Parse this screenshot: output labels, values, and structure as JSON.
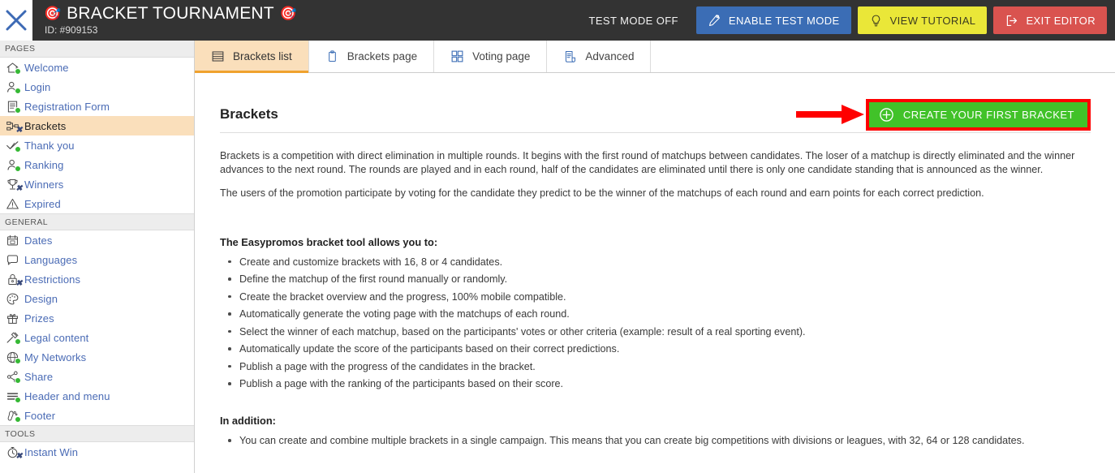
{
  "topbar": {
    "close_icon": "close-x-icon",
    "title": "BRACKET TOURNAMENT",
    "emoji_left": "🎯",
    "emoji_right": "🎯",
    "id_label": "ID: #909153",
    "test_mode_status": "TEST MODE OFF",
    "buttons": [
      {
        "label": "ENABLE TEST MODE",
        "icon": "test-tube-icon",
        "color": "#3b6db5"
      },
      {
        "label": "VIEW TUTORIAL",
        "icon": "lightbulb-icon",
        "color": "#eae738"
      },
      {
        "label": "EXIT EDITOR",
        "icon": "exit-arrow-icon",
        "color": "#d9534f"
      }
    ]
  },
  "sidebar": {
    "sections": [
      {
        "title": "PAGES",
        "items": [
          {
            "label": "Welcome",
            "icon": "home-icon",
            "badge": "dot",
            "active": false
          },
          {
            "label": "Login",
            "icon": "user-key-icon",
            "badge": "dot",
            "active": false
          },
          {
            "label": "Registration Form",
            "icon": "form-icon",
            "badge": "dot",
            "active": false
          },
          {
            "label": "Brackets",
            "icon": "bracket-icon",
            "badge": "x",
            "active": true
          },
          {
            "label": "Thank you",
            "icon": "check-icon",
            "badge": "dot",
            "active": false
          },
          {
            "label": "Ranking",
            "icon": "user-rank-icon",
            "badge": "dot",
            "active": false
          },
          {
            "label": "Winners",
            "icon": "trophy-icon",
            "badge": "x",
            "active": false
          },
          {
            "label": "Expired",
            "icon": "warning-icon",
            "badge": "none",
            "active": false
          }
        ]
      },
      {
        "title": "GENERAL",
        "items": [
          {
            "label": "Dates",
            "icon": "calendar-icon",
            "badge": "none",
            "active": false
          },
          {
            "label": "Languages",
            "icon": "speech-bubble-icon",
            "badge": "none",
            "active": false
          },
          {
            "label": "Restrictions",
            "icon": "lock-icon",
            "badge": "x",
            "active": false
          },
          {
            "label": "Design",
            "icon": "palette-icon",
            "badge": "none",
            "active": false
          },
          {
            "label": "Prizes",
            "icon": "gift-icon",
            "badge": "none",
            "active": false
          },
          {
            "label": "Legal content",
            "icon": "gavel-icon",
            "badge": "dot",
            "active": false
          },
          {
            "label": "My Networks",
            "icon": "network-globe-icon",
            "badge": "dot",
            "active": false
          },
          {
            "label": "Share",
            "icon": "share-icon",
            "badge": "dot",
            "active": false
          },
          {
            "label": "Header and menu",
            "icon": "menu-lines-icon",
            "badge": "dot",
            "active": false
          },
          {
            "label": "Footer",
            "icon": "footprint-icon",
            "badge": "dot",
            "active": false
          }
        ]
      },
      {
        "title": "TOOLS",
        "items": [
          {
            "label": "Instant Win",
            "icon": "stopwatch-icon",
            "badge": "x",
            "active": false
          }
        ]
      }
    ]
  },
  "tabs": [
    {
      "label": "Brackets list",
      "icon": "list-rows-icon",
      "active": true
    },
    {
      "label": "Brackets page",
      "icon": "clipboard-icon",
      "active": false
    },
    {
      "label": "Voting page",
      "icon": "grid-squares-icon",
      "active": false
    },
    {
      "label": "Advanced",
      "icon": "scroll-document-icon",
      "active": false
    }
  ],
  "main": {
    "page_title": "Brackets",
    "cta_label": "CREATE YOUR FIRST BRACKET",
    "cta_icon": "plus-circle-icon",
    "cta_color": "#41c229",
    "annotation_color": "#ff0000",
    "paragraphs": [
      "Brackets is a competition with direct elimination in multiple rounds. It begins with the first round of matchups between candidates. The loser of a matchup is directly eliminated and the winner advances to the next round. The rounds are played and in each round, half of the candidates are eliminated until there is only one candidate standing that is announced as the winner.",
      "The users of the promotion participate by voting for the candidate they predict to be the winner of the matchups of each round and earn points for each correct prediction."
    ],
    "features_heading": "The Easypromos bracket tool allows you to:",
    "features": [
      "Create and customize brackets with 16, 8 or 4 candidates.",
      "Define the matchup of the first round manually or randomly.",
      "Create the bracket overview and the progress, 100% mobile compatible.",
      "Automatically generate the voting page with the matchups of each round.",
      "Select the winner of each matchup, based on the participants' votes or other criteria (example: result of a real sporting event).",
      "Automatically update the score of the participants based on their correct predictions.",
      "Publish a page with the progress of the candidates in the bracket.",
      "Publish a page with the ranking of the participants based on their score."
    ],
    "addition_heading": "In addition:",
    "addition_items": [
      "You can create and combine multiple brackets in a single campaign. This means that you can create big competitions with divisions or leagues, with 32, 64 or 128 candidates."
    ]
  }
}
